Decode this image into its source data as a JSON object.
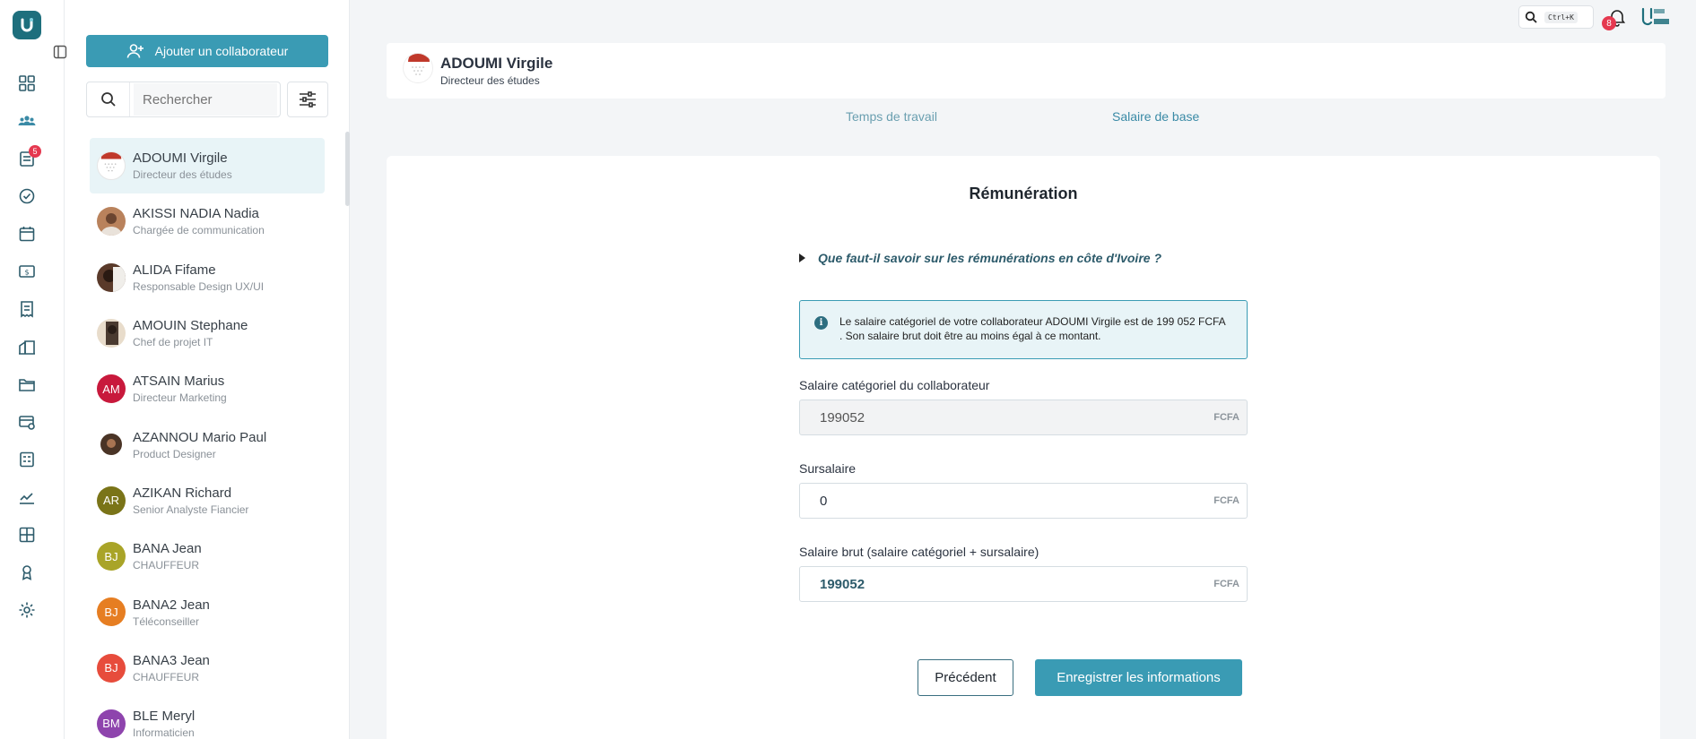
{
  "sidebar": {
    "notification_badge": "5",
    "icons": [
      "dashboard-icon",
      "team-icon",
      "requests-icon",
      "check-circle-icon",
      "calendar-icon",
      "payroll-icon",
      "receipt-icon",
      "buildings-icon",
      "folder-icon",
      "card-settings-icon",
      "calculator-icon",
      "chart-icon",
      "grid-icon",
      "award-icon",
      "gear-icon"
    ]
  },
  "employees_panel": {
    "add_button_label": "Ajouter un collaborateur",
    "search_placeholder": "Rechercher",
    "employees": [
      {
        "name": "ADOUMI Virgile",
        "role": "Directeur des études",
        "initials": "",
        "color": "#ffffff",
        "active": true
      },
      {
        "name": "AKISSI NADIA Nadia",
        "role": "Chargée de communication",
        "initials": "",
        "color": "#b9825c"
      },
      {
        "name": "ALIDA Fifame",
        "role": "Responsable Design UX/UI",
        "initials": "",
        "color": "#5a3a2a"
      },
      {
        "name": "AMOUIN Stephane",
        "role": "Chef de projet IT",
        "initials": "",
        "color": "#d9c8b0"
      },
      {
        "name": "ATSAIN Marius",
        "role": "Directeur Marketing",
        "initials": "AM",
        "color": "#c8193c"
      },
      {
        "name": "AZANNOU Mario Paul",
        "role": "Product Designer",
        "initials": "",
        "color": "#4a3426"
      },
      {
        "name": "AZIKAN Richard",
        "role": "Senior Analyste Fiancier",
        "initials": "AR",
        "color": "#7a7418"
      },
      {
        "name": "BANA Jean",
        "role": "CHAUFFEUR",
        "initials": "BJ",
        "color": "#a9a428"
      },
      {
        "name": "BANA2 Jean",
        "role": "Téléconseiller",
        "initials": "BJ",
        "color": "#e67e22"
      },
      {
        "name": "BANA3 Jean",
        "role": "CHAUFFEUR",
        "initials": "BJ",
        "color": "#e74c3c"
      },
      {
        "name": "BLE Meryl",
        "role": "Informaticien",
        "initials": "BM",
        "color": "#8e44ad"
      }
    ]
  },
  "topbar": {
    "search_shortcut": "Ctrl+K",
    "notifications_count": "8"
  },
  "header": {
    "name": "ADOUMI Virgile",
    "role": "Directeur des études"
  },
  "tabs": [
    {
      "label": "Temps de travail"
    },
    {
      "label": "Salaire de base"
    }
  ],
  "form": {
    "title": "Rémunération",
    "faq_label": "Que faut-il savoir sur les rémunérations en côte d'Ivoire ?",
    "info_text": "Le salaire catégoriel de votre collaborateur ADOUMI Virgile est de 199 052 FCFA . Son salaire brut doit être au moins égal à ce montant.",
    "fields": [
      {
        "label": "Salaire catégoriel du collaborateur",
        "value": "199052",
        "unit": "FCFA"
      },
      {
        "label": "Sursalaire",
        "value": "0",
        "unit": "FCFA"
      },
      {
        "label": "Salaire brut (salaire catégoriel + sursalaire)",
        "value": "199052",
        "unit": "FCFA"
      }
    ],
    "prev_button": "Précédent",
    "save_button": "Enregistrer les informations"
  },
  "colors": {
    "accent": "#3a9bb4",
    "badge": "#e53950",
    "brand": "#1e6f7d"
  }
}
